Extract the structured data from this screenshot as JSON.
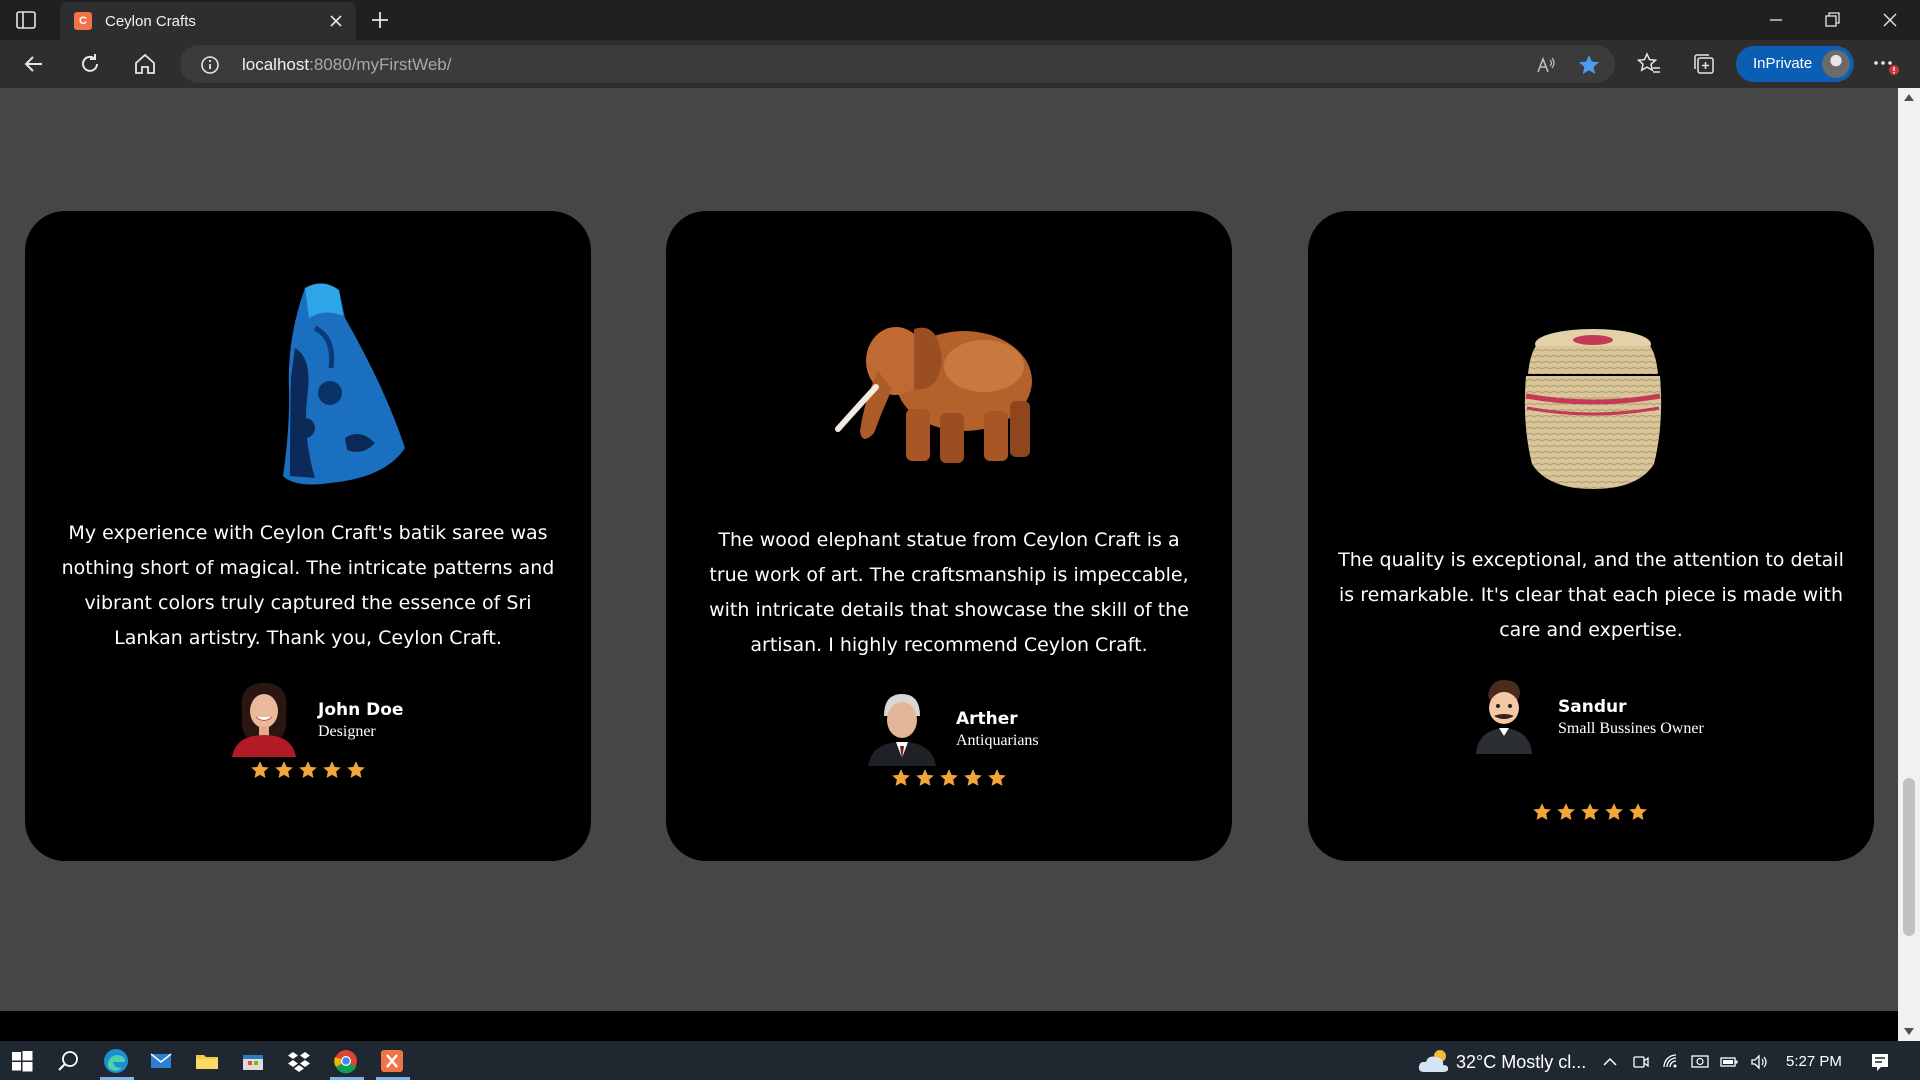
{
  "browser": {
    "tab_title": "Ceylon Crafts",
    "url_host": "localhost",
    "url_rest": ":8080/myFirstWeb/",
    "inprivate_label": "InPrivate"
  },
  "testimonials": [
    {
      "product": "batik saree",
      "quote": "My experience with Ceylon Craft's batik saree was nothing short of magical. The intricate patterns and vibrant colors truly captured the essence of Sri Lankan artistry. Thank you, Ceylon Craft.",
      "name": "John Doe",
      "role": "Designer",
      "rating": 5
    },
    {
      "product": "wood elephant statue",
      "quote": "The wood elephant statue from Ceylon Craft is a true work of art. The craftsmanship is impeccable, with intricate details that showcase the skill of the artisan. I highly recommend Ceylon Craft.",
      "name": "Arther",
      "role": "Antiquarians",
      "rating": 5
    },
    {
      "product": "woven basket",
      "quote": "The quality is exceptional, and the attention to detail is remarkable. It's clear that each piece is made with care and expertise.",
      "name": "Sandur",
      "role": "Small Bussines Owner",
      "rating": 5
    }
  ],
  "colors": {
    "page_bg": "#464646",
    "card_bg": "#000000",
    "star": "#f0a63a",
    "back_to_top": "#7a21d8"
  },
  "taskbar": {
    "weather": "32°C  Mostly cl...",
    "time": "5:27 PM"
  }
}
